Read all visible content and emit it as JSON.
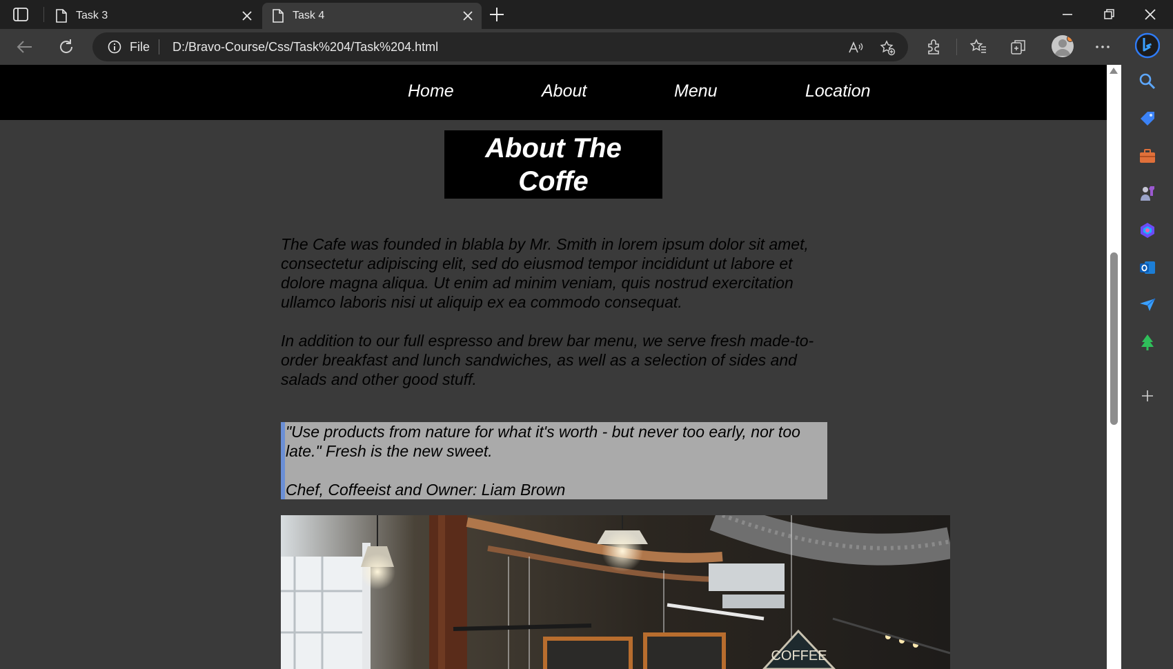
{
  "browser": {
    "tabs": [
      {
        "title": "Task 3",
        "active": false
      },
      {
        "title": "Task 4",
        "active": true
      }
    ],
    "address": {
      "scheme_label": "File",
      "url": "D:/Bravo-Course/Css/Task%204/Task%204.html"
    },
    "read_aloud_label": "A̲"
  },
  "page": {
    "nav": {
      "items": [
        "Home",
        "About",
        "Menu",
        "Location"
      ]
    },
    "title": "About The Coffe",
    "paragraphs": [
      "The Cafe was founded in blabla by Mr. Smith in lorem ipsum dolor sit amet, consectetur adipiscing elit, sed do eiusmod tempor incididunt ut labore et dolore magna aliqua. Ut enim ad minim veniam, quis nostrud exercitation ullamco laboris nisi ut aliquip ex ea commodo consequat.",
      "In addition to our full espresso and brew bar menu, we serve fresh made-to-order breakfast and lunch sandwiches, as well as a selection of sides and salads and other good stuff."
    ],
    "quote": {
      "text": "\"Use products from nature for what it's worth - but never too early, nor too late.\" Fresh is the new sweet.",
      "author": "Chef, Coffeeist and Owner: Liam Brown"
    },
    "photo_sign": "COFFEE",
    "colors": {
      "nav_bg": "#000000",
      "page_bg": "#3a3a3a",
      "quote_bg": "#aaaaaa",
      "quote_border": "#6b8fd6"
    }
  }
}
